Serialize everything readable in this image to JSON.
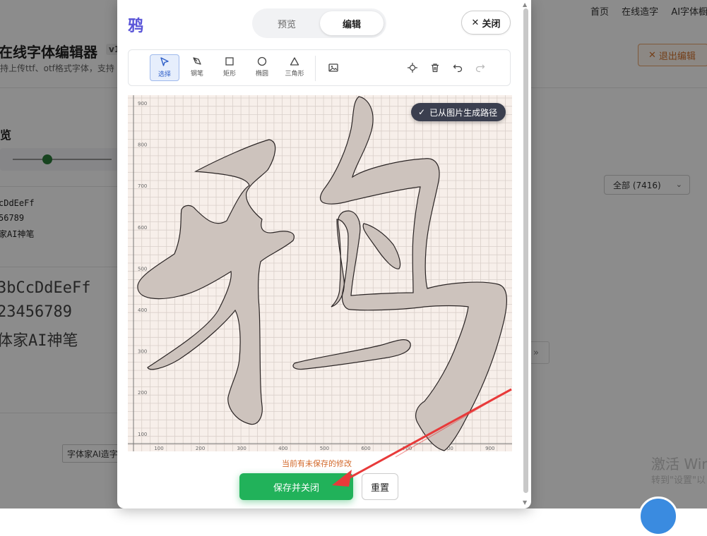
{
  "background": {
    "nav": [
      "首页",
      "在线造字",
      "AI字体橱"
    ],
    "title": "在线字体编辑器",
    "version": "v1",
    "subtitle": "持上传ttf、otf格式字体，支持",
    "exit_button": "退出编辑",
    "preview_heading": "览",
    "sample_mono": [
      "cDdEeFf",
      "56789",
      "家AI神笔"
    ],
    "sample_big": [
      "3bCcDdEeFf",
      "23456789",
      "体家AI神笔"
    ],
    "filter_select": "全部 (7416)",
    "font_button": "字体家AI造字",
    "pager": "»",
    "watermark_main": "激活 Wir",
    "watermark_sub": "转到\"设置\"以"
  },
  "modal": {
    "glyph_title": "鸦",
    "tabs": [
      {
        "label": "预览",
        "active": false
      },
      {
        "label": "编辑",
        "active": true
      }
    ],
    "close_label": "关闭",
    "tools": [
      {
        "label": "选择",
        "icon": "cursor-icon",
        "active": true
      },
      {
        "label": "钢笔",
        "icon": "pen-icon",
        "active": false
      },
      {
        "label": "矩形",
        "icon": "rectangle-icon",
        "active": false
      },
      {
        "label": "椭圆",
        "icon": "ellipse-icon",
        "active": false
      },
      {
        "label": "三角形",
        "icon": "triangle-icon",
        "active": false
      }
    ],
    "toolbar_icons": [
      "image-icon",
      "crosshair-icon",
      "trash-icon",
      "undo-icon",
      "redo-icon"
    ],
    "badge": "已从图片生成路径",
    "unsaved_notice": "当前有未保存的修改",
    "save_label": "保存并关闭",
    "reset_label": "重置",
    "axis": {
      "x_ticks": [
        "100",
        "200",
        "300",
        "400",
        "500",
        "600",
        "700",
        "800",
        "900"
      ],
      "y_ticks": [
        "900",
        "800",
        "700",
        "600",
        "500",
        "400",
        "300",
        "200",
        "100"
      ]
    }
  },
  "colors": {
    "accent": "#5a55d8",
    "save": "#21b25a",
    "warning": "#d2692a",
    "glyph_fill": "#cdc3bd",
    "canvas_bg": "#f7efea",
    "arrow": "#e83a3a"
  }
}
